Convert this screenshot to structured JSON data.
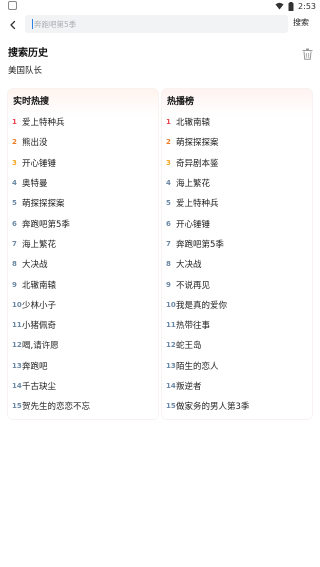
{
  "status_bar": {
    "time": "2:53"
  },
  "search": {
    "placeholder": "奔跑吧第5季",
    "value": "",
    "button_label": "搜索"
  },
  "history": {
    "title": "搜索历史",
    "items": [
      "美国队长"
    ]
  },
  "realtime": {
    "title": "实时热搜",
    "items": [
      {
        "rank": "1",
        "name": "爱上特种兵"
      },
      {
        "rank": "2",
        "name": "熊出没"
      },
      {
        "rank": "3",
        "name": "开心锤锤"
      },
      {
        "rank": "4",
        "name": "奥特曼"
      },
      {
        "rank": "5",
        "name": "萌探探探案"
      },
      {
        "rank": "6",
        "name": "奔跑吧第5季"
      },
      {
        "rank": "7",
        "name": "海上繁花"
      },
      {
        "rank": "8",
        "name": "大决战"
      },
      {
        "rank": "9",
        "name": "北辙南辕"
      },
      {
        "rank": "10",
        "name": "少林小子"
      },
      {
        "rank": "11",
        "name": "小猪佩奇"
      },
      {
        "rank": "12",
        "name": "喝,请许愿"
      },
      {
        "rank": "13",
        "name": "奔跑吧"
      },
      {
        "rank": "14",
        "name": "千古玦尘"
      },
      {
        "rank": "15",
        "name": "贺先生的恋恋不忘"
      }
    ]
  },
  "hot": {
    "title": "热播榜",
    "items": [
      {
        "rank": "1",
        "name": "北辙南辕"
      },
      {
        "rank": "2",
        "name": "萌探探探案"
      },
      {
        "rank": "3",
        "name": "奇异剧本鉴"
      },
      {
        "rank": "4",
        "name": "海上繁花"
      },
      {
        "rank": "5",
        "name": "爱上特种兵"
      },
      {
        "rank": "6",
        "name": "开心锤锤"
      },
      {
        "rank": "7",
        "name": "奔跑吧第5季"
      },
      {
        "rank": "8",
        "name": "大决战"
      },
      {
        "rank": "9",
        "name": "不说再见"
      },
      {
        "rank": "10",
        "name": "我是真的爱你"
      },
      {
        "rank": "11",
        "name": "热带往事"
      },
      {
        "rank": "12",
        "name": "蛇王岛"
      },
      {
        "rank": "13",
        "name": "陌生的恋人"
      },
      {
        "rank": "14",
        "name": "叛逆者"
      },
      {
        "rank": "15",
        "name": "做家务的男人第3季"
      }
    ]
  },
  "colors": {
    "rank1": "#e8424a",
    "rank2": "#f07a21",
    "rank3": "#f5a623",
    "rank_other": "#6a87a3",
    "caret": "#2a82e4"
  },
  "icons": [
    "notification-icon",
    "wifi-icon",
    "battery-icon",
    "back-arrow-icon",
    "trash-icon"
  ]
}
